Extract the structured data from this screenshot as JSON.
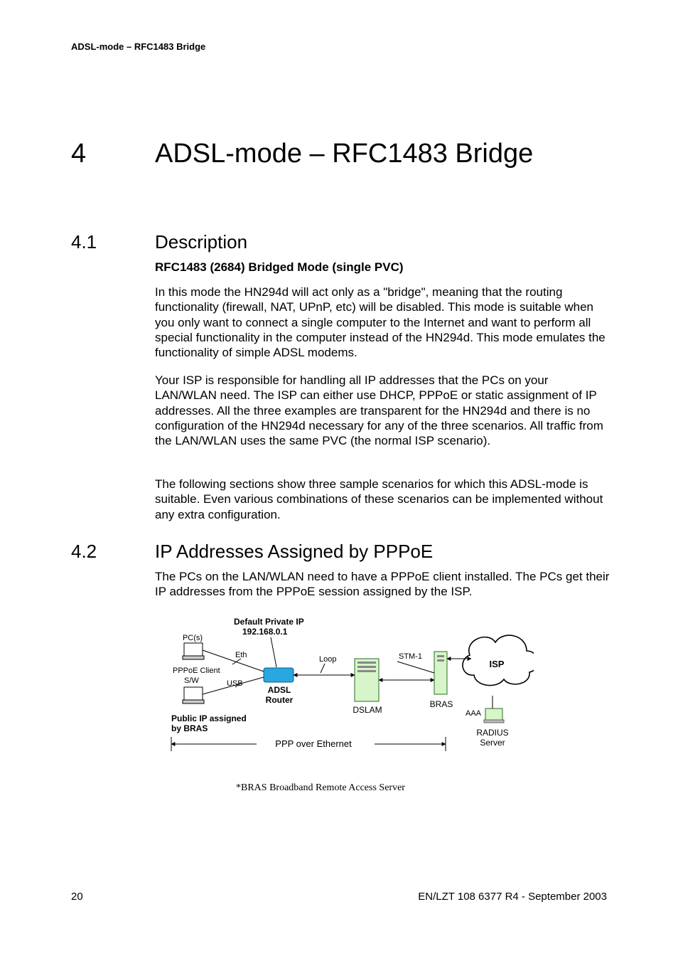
{
  "running_head": "ADSL-mode – RFC1483 Bridge",
  "chapter": {
    "num": "4",
    "title": "ADSL-mode – RFC1483 Bridge"
  },
  "s41": {
    "num": "4.1",
    "title": "Description",
    "sub": "RFC1483 (2684) Bridged Mode (single PVC)",
    "p1": "In this mode the HN294d will act only as a \"bridge\", meaning that the routing functionality (firewall, NAT, UPnP, etc) will be disabled. This mode is suitable when you only want to connect a single computer to the Internet and want to perform all special functionality in the computer instead of the HN294d. This mode emulates the functionality of simple ADSL modems.",
    "p2": "Your ISP is responsible for handling all IP addresses that the PCs on your LAN/WLAN need. The ISP can either use DHCP, PPPoE or static assignment of IP addresses. All the three examples are transparent for the HN294d and there is no configuration of the HN294d necessary for any of the three scenarios. All traffic from the LAN/WLAN uses the same PVC (the normal ISP scenario).",
    "p3": "The following sections show three sample scenarios for which this ADSL-mode is suitable. Even various combinations of these scenarios can be implemented without any extra configuration."
  },
  "s42": {
    "num": "4.2",
    "title": "IP Addresses Assigned by PPPoE",
    "p1": "The PCs on the LAN/WLAN need to have a PPPoE client installed. The PCs get their IP addresses from the PPPoE session assigned by the ISP."
  },
  "diagram": {
    "default_ip_l1": "Default Private IP",
    "default_ip_l2": "192.168.0.1",
    "pcs": "PC(s)",
    "pppoe_client": "PPPoE Client",
    "saw": "S/W",
    "eth": "Eth",
    "usb": "USB",
    "adsl_router_l1": "ADSL",
    "adsl_router_l2": "Router",
    "loop": "Loop",
    "dslam": "DSLAM",
    "stm1": "STM-1",
    "bras": "BRAS",
    "isp": "ISP",
    "aaa": "AAA",
    "radius_l1": "RADIUS",
    "radius_l2": "Server",
    "pub_ip_l1": "Public IP assigned",
    "pub_ip_l2": "by BRAS",
    "ppp_over_eth": "PPP over Ethernet",
    "footnote": "*BRAS   Broadband Remote Access Server"
  },
  "footer": {
    "page": "20",
    "right": "EN/LZT 108 6377 R4 - September 2003"
  }
}
